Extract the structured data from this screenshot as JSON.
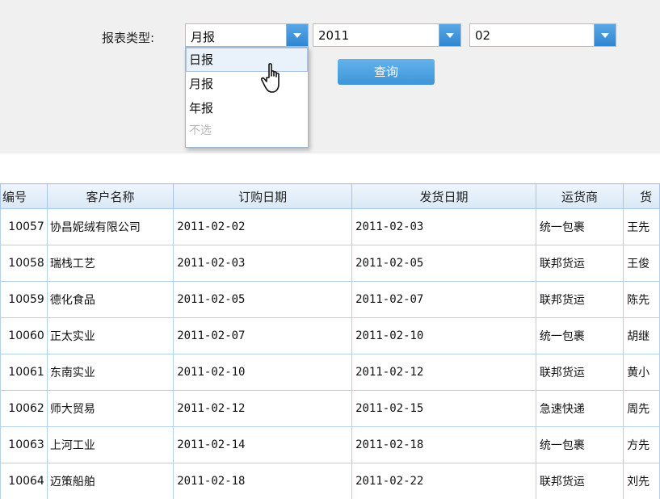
{
  "filter": {
    "label": "报表类型:",
    "report_type": {
      "value": "月报",
      "options": [
        "日报",
        "月报",
        "年报",
        "不选"
      ],
      "hover_index": 0
    },
    "year": {
      "value": "2011"
    },
    "month": {
      "value": "02"
    },
    "query_label": "查询"
  },
  "table": {
    "headers": [
      "编号",
      "客户名称",
      "订购日期",
      "发货日期",
      "运货商",
      "货"
    ],
    "rows": [
      [
        "10057",
        "协昌妮绒有限公司",
        "2011-02-02",
        "2011-02-03",
        "统一包裹",
        "王先"
      ],
      [
        "10058",
        "瑞栈工艺",
        "2011-02-03",
        "2011-02-05",
        "联邦货运",
        "王俊"
      ],
      [
        "10059",
        "德化食品",
        "2011-02-05",
        "2011-02-07",
        "联邦货运",
        "陈先"
      ],
      [
        "10060",
        "正太实业",
        "2011-02-07",
        "2011-02-10",
        "统一包裹",
        "胡继"
      ],
      [
        "10061",
        "东南实业",
        "2011-02-10",
        "2011-02-12",
        "联邦货运",
        "黄小"
      ],
      [
        "10062",
        "师大贸易",
        "2011-02-12",
        "2011-02-15",
        "急速快递",
        "周先"
      ],
      [
        "10063",
        "上河工业",
        "2011-02-14",
        "2011-02-18",
        "统一包裹",
        "方先"
      ],
      [
        "10064",
        "迈策船舶",
        "2011-02-18",
        "2011-02-22",
        "联邦货运",
        "刘先"
      ]
    ]
  },
  "colors": {
    "accent": "#3d95d8",
    "header_bg": "#d9e8f6",
    "border": "#b7d0ea"
  },
  "icons": {
    "dropdown_arrow": "chevron-down-icon",
    "cursor": "hand-pointer-icon"
  }
}
